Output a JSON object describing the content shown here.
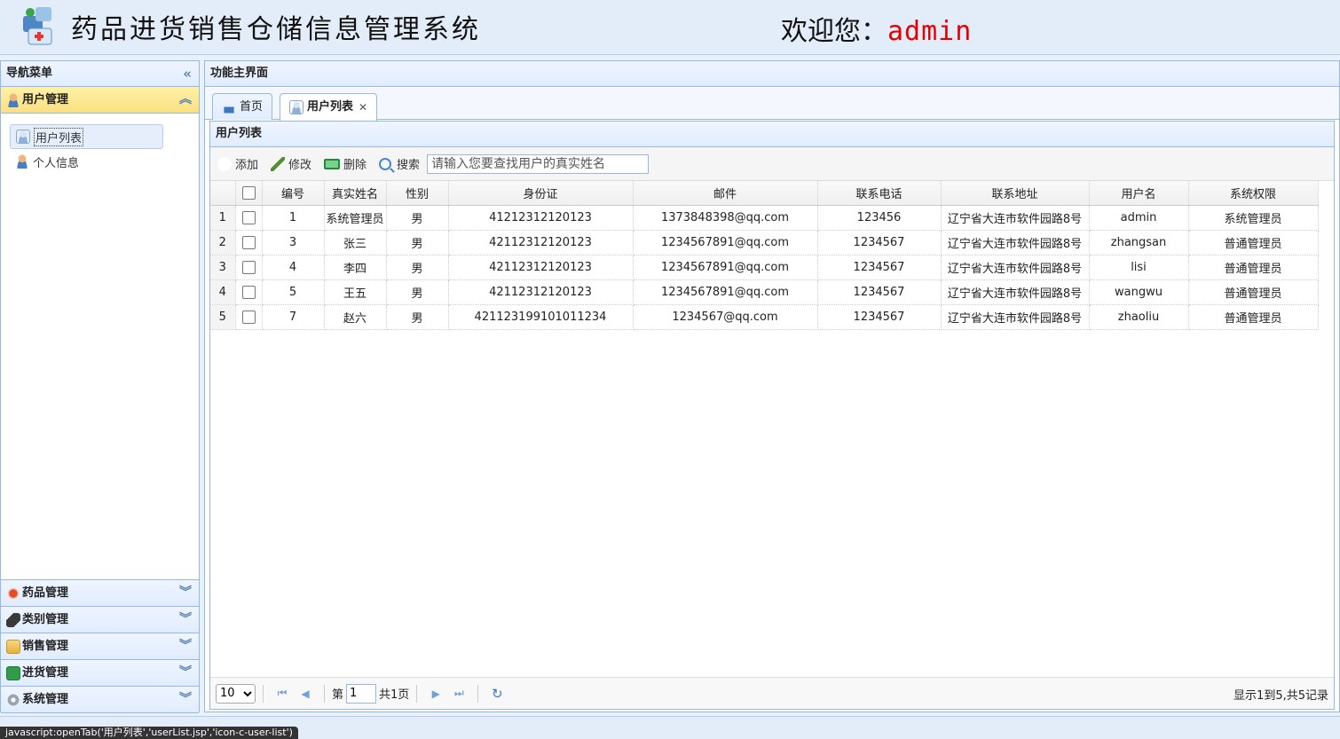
{
  "header": {
    "title": "药品进货销售仓储信息管理系统",
    "welcome_prefix": "欢迎您：",
    "username": "admin"
  },
  "nav": {
    "title": "导航菜单",
    "active_section": {
      "label": "用户管理",
      "icon": "user-icon"
    },
    "items": [
      {
        "label": "用户列表",
        "icon": "user-list-icon",
        "selected": true
      },
      {
        "label": "个人信息",
        "icon": "user-icon",
        "selected": false
      }
    ],
    "sections": [
      {
        "label": "药品管理",
        "icon": "drug-icon"
      },
      {
        "label": "类别管理",
        "icon": "tag-icon"
      },
      {
        "label": "销售管理",
        "icon": "folder-icon"
      },
      {
        "label": "进货管理",
        "icon": "list-icon"
      },
      {
        "label": "系统管理",
        "icon": "gear-icon"
      }
    ]
  },
  "main": {
    "title": "功能主界面",
    "tabs": [
      {
        "label": "首页",
        "icon": "home-icon"
      },
      {
        "label": "用户列表",
        "icon": "user-list-icon",
        "active": true
      }
    ],
    "list_title": "用户列表",
    "toolbar": {
      "add": "添加",
      "edit": "修改",
      "delete": "删除",
      "search": "搜索",
      "search_placeholder": "请输入您要查找用户的真实姓名"
    },
    "columns": [
      "编号",
      "真实姓名",
      "性别",
      "身份证",
      "邮件",
      "联系电话",
      "联系地址",
      "用户名",
      "系统权限"
    ],
    "rows": [
      {
        "n": "1",
        "id": "1",
        "name": "系统管理员",
        "gender": "男",
        "idcard": "41212312120123",
        "email": "1373848398@qq.com",
        "phone": "123456",
        "address": "辽宁省大连市软件园路8号",
        "username": "admin",
        "role": "系统管理员"
      },
      {
        "n": "2",
        "id": "3",
        "name": "张三",
        "gender": "男",
        "idcard": "42112312120123",
        "email": "1234567891@qq.com",
        "phone": "1234567",
        "address": "辽宁省大连市软件园路8号",
        "username": "zhangsan",
        "role": "普通管理员"
      },
      {
        "n": "3",
        "id": "4",
        "name": "李四",
        "gender": "男",
        "idcard": "42112312120123",
        "email": "1234567891@qq.com",
        "phone": "1234567",
        "address": "辽宁省大连市软件园路8号",
        "username": "lisi",
        "role": "普通管理员"
      },
      {
        "n": "4",
        "id": "5",
        "name": "王五",
        "gender": "男",
        "idcard": "42112312120123",
        "email": "1234567891@qq.com",
        "phone": "1234567",
        "address": "辽宁省大连市软件园路8号",
        "username": "wangwu",
        "role": "普通管理员"
      },
      {
        "n": "5",
        "id": "7",
        "name": "赵六",
        "gender": "男",
        "idcard": "421123199101011234",
        "email": "1234567@qq.com",
        "phone": "1234567",
        "address": "辽宁省大连市软件园路8号",
        "username": "zhaoliu",
        "role": "普通管理员"
      }
    ],
    "pager": {
      "page_size": "10",
      "page_prefix": "第",
      "page": "1",
      "page_suffix": "共1页",
      "info": "显示1到5,共5记录"
    }
  },
  "status_tip": "javascript:openTab('用户列表','userList.jsp','icon-c-user-list')"
}
